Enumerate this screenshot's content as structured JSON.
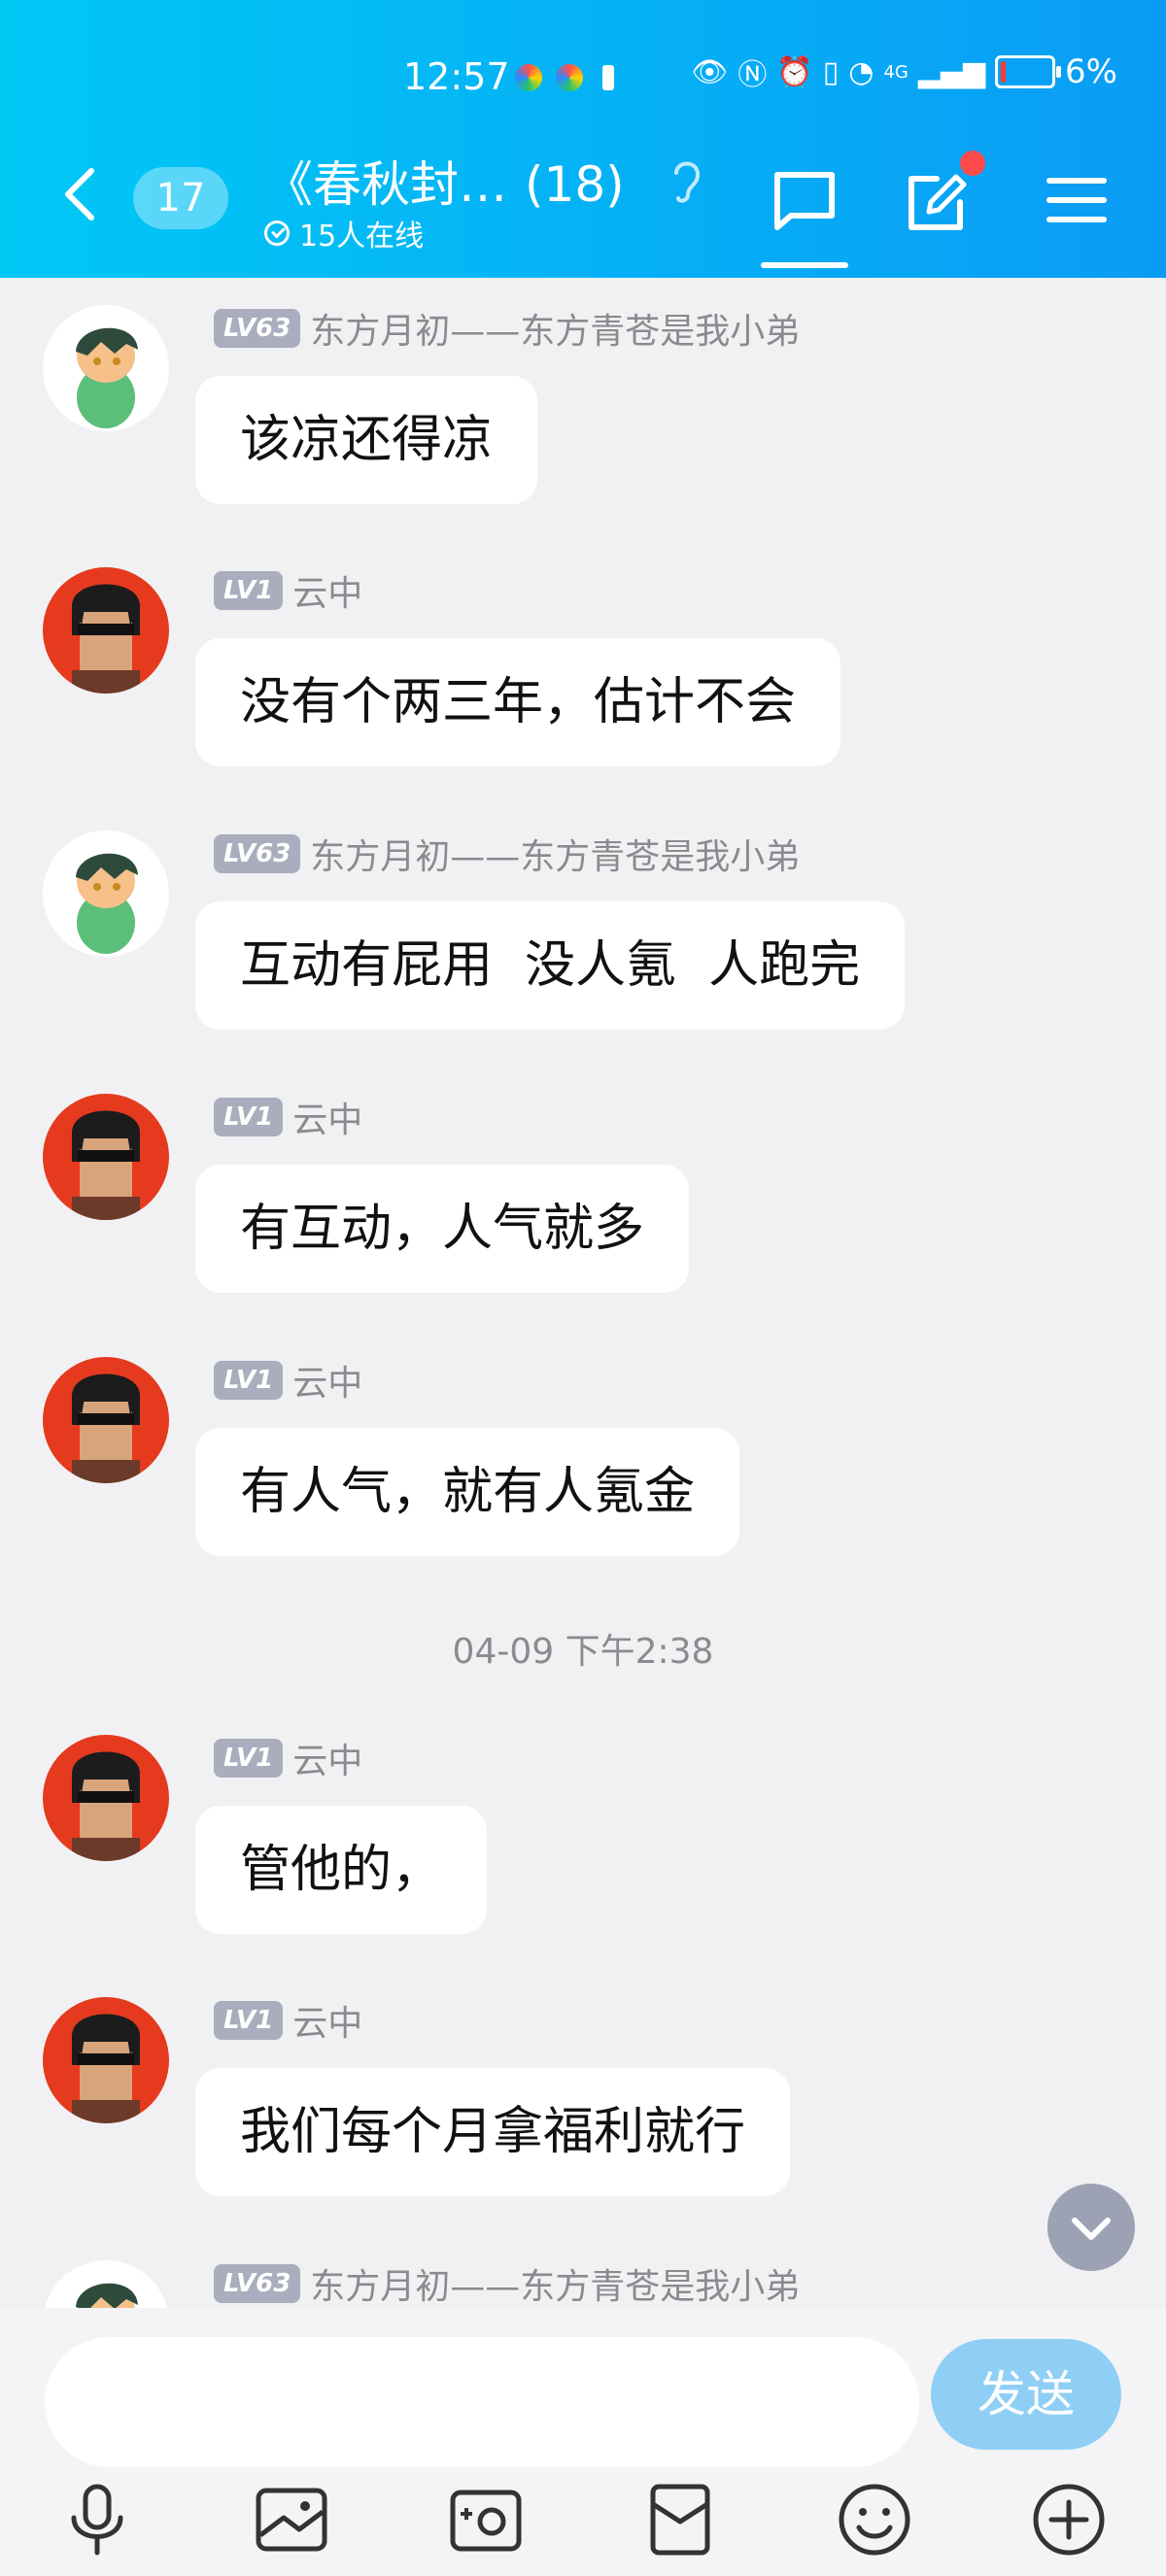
{
  "status_bar": {
    "time": "12:57",
    "battery_percent": "6%",
    "network_label": "4G"
  },
  "header": {
    "unread_count": "17",
    "group_title": "《春秋封…",
    "member_count": "(18)",
    "online_text": "15人在线"
  },
  "messages": [
    {
      "level": "LV63",
      "sender": "东方月初——东方青苍是我小弟",
      "text": "该凉还得凉",
      "avatar": "green-dino-avatar"
    },
    {
      "level": "LV1",
      "sender": "云中",
      "text": "没有个两三年，估计不会",
      "avatar": "sunglasses-avatar"
    },
    {
      "level": "LV63",
      "sender": "东方月初——东方青苍是我小弟",
      "text": "互动有屁用  没人氪  人跑完",
      "avatar": "green-dino-avatar"
    },
    {
      "level": "LV1",
      "sender": "云中",
      "text": "有互动，人气就多",
      "avatar": "sunglasses-avatar"
    },
    {
      "level": "LV1",
      "sender": "云中",
      "text": "有人气，就有人氪金",
      "avatar": "sunglasses-avatar"
    },
    {
      "level": "LV1",
      "sender": "云中",
      "text": "管他的，",
      "avatar": "sunglasses-avatar"
    },
    {
      "level": "LV1",
      "sender": "云中",
      "text": "我们每个月拿福利就行",
      "avatar": "sunglasses-avatar"
    },
    {
      "level": "LV63",
      "sender": "东方月初——东方青苍是我小弟",
      "text": "",
      "avatar": "green-dino-avatar"
    }
  ],
  "time_separator": "04-09 下午2:38",
  "input": {
    "placeholder": "",
    "send_label": "发送"
  },
  "colors": {
    "header_start": "#00c8f5",
    "header_end": "#0a9cf5",
    "send_button": "#8fcff5",
    "badge_red": "#ff4b4b"
  }
}
